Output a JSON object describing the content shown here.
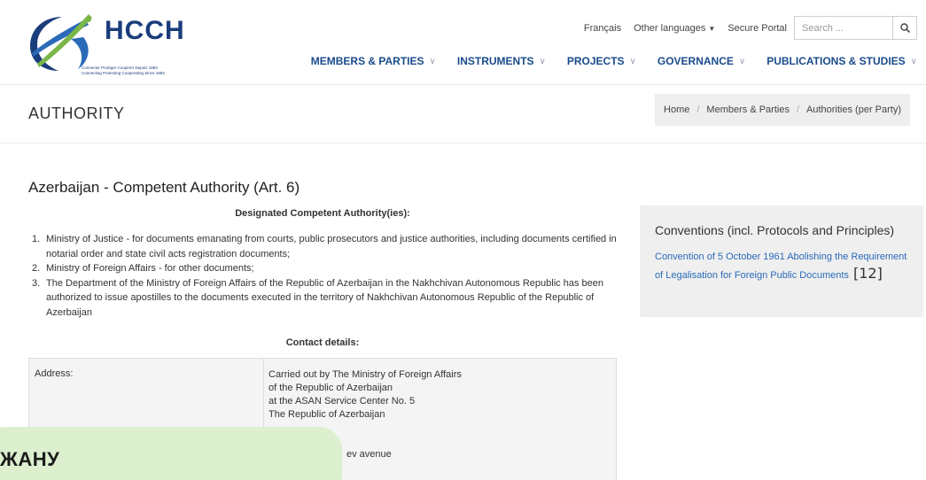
{
  "logo": {
    "brand": "HCCH",
    "tagline1": "Connecter  Protéger  Coopérer  Depuis 1893",
    "tagline2": "Connecting  Protecting  Cooperating  Since 1893"
  },
  "topbar": {
    "francais": "Français",
    "other_languages": "Other languages",
    "secure_portal": "Secure Portal",
    "search_placeholder": "Search ..."
  },
  "nav": {
    "members": "MEMBERS & PARTIES",
    "instruments": "INSTRUMENTS",
    "projects": "PROJECTS",
    "governance": "GOVERNANCE",
    "publications": "PUBLICATIONS & STUDIES"
  },
  "page": {
    "title": "AUTHORITY",
    "breadcrumb": [
      "Home",
      "Members & Parties",
      "Authorities (per Party)"
    ]
  },
  "content": {
    "title": "Azerbaijan - Competent Authority (Art. 6)",
    "designated_heading": "Designated Competent Authority(ies):",
    "items": [
      {
        "num": "1.",
        "text": "Ministry of Justice - for documents emanating from courts, public prosecutors and justice authorities, including documents certified in notarial order and state civil acts registration documents;"
      },
      {
        "num": "2.",
        "text": "Ministry of Foreign Affairs - for other documents;"
      },
      {
        "num": "3.",
        "text": "The Department of the Ministry of Foreign Affairs of the Republic of Azerbaijan in the Nakhchivan Autonomous Republic has been authorized to issue apostilles to the documents executed in the territory of Nakhchivan Autonomous Republic of the Republic of Azerbaijan"
      }
    ],
    "contact_heading": "Contact details:",
    "address_label": "Address:",
    "address_lines": [
      "Carried out by The Ministry of Foreign Affairs",
      "of the Republic of Azerbaijan",
      "at the ASAN Service Center No. 5",
      "The Republic of Azerbaijan"
    ],
    "address_partial": "ev avenue"
  },
  "sidebar": {
    "title": "Conventions (incl. Protocols and Principles)",
    "link": "Convention of 5 October 1961 Abolishing the Requirement of Legalisation for Foreign Public Documents",
    "count": "[12]"
  },
  "overlay": {
    "text": "ЖАНУ"
  },
  "colors": {
    "nav_blue": "#1a4b8c",
    "link_blue": "#2a6ab8",
    "logo_green": "#7ab648",
    "overlay_green": "#dcf0cf"
  }
}
